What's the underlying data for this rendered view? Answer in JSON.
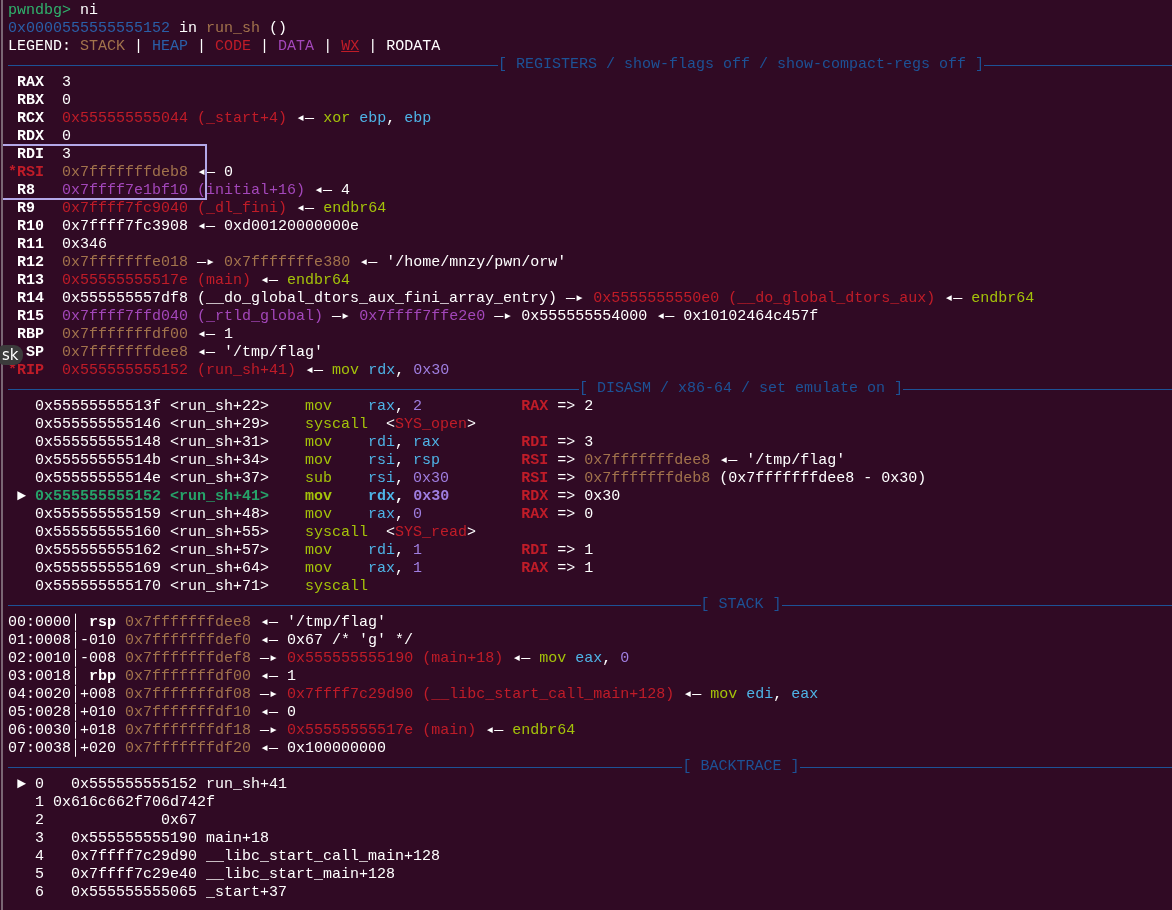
{
  "tooltip": {
    "text": "sk"
  },
  "lines": [
    {
      "kind": "text",
      "segments": [
        {
          "text": "pwndbg> ",
          "color": "#2fb36d",
          "kind": "plain"
        },
        {
          "text": "ni",
          "kind": "plain"
        }
      ]
    },
    {
      "kind": "text",
      "segments": [
        {
          "text": "0x0000555555555152",
          "color": "#2a5fa8",
          "kind": "plain"
        },
        {
          "text": " in ",
          "kind": "plain"
        },
        {
          "text": "run_sh",
          "color": "#a2734c",
          "kind": "plain"
        },
        {
          "text": " ()",
          "kind": "plain"
        }
      ]
    },
    {
      "kind": "text",
      "segments": [
        {
          "text": "LEGEND: ",
          "kind": "plain"
        },
        {
          "text": "STACK",
          "color": "#a2734c",
          "kind": "plain"
        },
        {
          "text": " | ",
          "kind": "plain"
        },
        {
          "text": "HEAP",
          "color": "#2a5fa8",
          "kind": "plain"
        },
        {
          "text": " | ",
          "kind": "plain"
        },
        {
          "text": "CODE",
          "color": "#c01c28",
          "kind": "plain"
        },
        {
          "text": " | ",
          "kind": "plain"
        },
        {
          "text": "DATA",
          "color": "#a347ba",
          "kind": "plain"
        },
        {
          "text": " | ",
          "kind": "plain"
        },
        {
          "text": "WX",
          "color": "#c01c28",
          "kind": "underline"
        },
        {
          "text": " | ",
          "kind": "plain"
        },
        {
          "text": "RODATA",
          "kind": "plain"
        }
      ]
    },
    {
      "kind": "rule",
      "title": "[ REGISTERS / show-flags off / show-compact-regs off ]"
    },
    {
      "kind": "text",
      "segments": [
        {
          "text": " RAX",
          "kind": "bold"
        },
        {
          "text": "  3",
          "kind": "plain"
        }
      ]
    },
    {
      "kind": "text",
      "segments": [
        {
          "text": " RBX",
          "kind": "bold"
        },
        {
          "text": "  0",
          "kind": "plain"
        }
      ]
    },
    {
      "kind": "text",
      "segments": [
        {
          "text": " RCX  ",
          "kind": "bold"
        },
        {
          "text": "0x555555555044 (_start+4)",
          "color": "#c01c28",
          "kind": "plain"
        },
        {
          "text": " ◂— ",
          "kind": "plain"
        },
        {
          "text": "xor ",
          "color": "#a4c20a",
          "kind": "plain"
        },
        {
          "text": "ebp",
          "color": "#4eb3e6",
          "kind": "plain"
        },
        {
          "text": ", ",
          "kind": "plain"
        },
        {
          "text": "ebp",
          "color": "#4eb3e6",
          "kind": "plain"
        }
      ]
    },
    {
      "kind": "text",
      "segments": [
        {
          "text": " RDX",
          "kind": "bold"
        },
        {
          "text": "  0",
          "kind": "plain"
        }
      ]
    },
    {
      "kind": "text",
      "segments": [
        {
          "text": " RDI",
          "kind": "bold"
        },
        {
          "text": "  3",
          "kind": "plain"
        }
      ]
    },
    {
      "kind": "text",
      "segments": [
        {
          "text": "*RSI  ",
          "color": "#c01c28",
          "kind": "bold"
        },
        {
          "text": "0x7fffffffdeb8",
          "color": "#a2734c",
          "kind": "plain"
        },
        {
          "text": " ◂— 0",
          "kind": "plain"
        }
      ]
    },
    {
      "kind": "text",
      "segments": [
        {
          "text": " R8   ",
          "kind": "bold"
        },
        {
          "text": "0x7ffff7e1bf10 (initial+16)",
          "color": "#a347ba",
          "kind": "plain"
        },
        {
          "text": " ◂— 4",
          "kind": "plain"
        }
      ]
    },
    {
      "kind": "text",
      "segments": [
        {
          "text": " R9   ",
          "kind": "bold"
        },
        {
          "text": "0x7ffff7fc9040 (_dl_fini)",
          "color": "#c01c28",
          "kind": "plain"
        },
        {
          "text": " ◂— ",
          "kind": "plain"
        },
        {
          "text": "endbr64",
          "color": "#a4c20a",
          "kind": "plain"
        }
      ]
    },
    {
      "kind": "text",
      "segments": [
        {
          "text": " R10",
          "kind": "bold"
        },
        {
          "text": "  0x7ffff7fc3908 ◂— 0xd00120000000e",
          "kind": "plain"
        }
      ]
    },
    {
      "kind": "text",
      "segments": [
        {
          "text": " R11",
          "kind": "bold"
        },
        {
          "text": "  0x346",
          "kind": "plain"
        }
      ]
    },
    {
      "kind": "text",
      "segments": [
        {
          "text": " R12  ",
          "kind": "bold"
        },
        {
          "text": "0x7fffffffe018",
          "color": "#a2734c",
          "kind": "plain"
        },
        {
          "text": " —▸ ",
          "kind": "plain"
        },
        {
          "text": "0x7fffffffe380",
          "color": "#a2734c",
          "kind": "plain"
        },
        {
          "text": " ◂— '/home/mnzy/pwn/orw'",
          "kind": "plain"
        }
      ]
    },
    {
      "kind": "text",
      "segments": [
        {
          "text": " R13  ",
          "kind": "bold"
        },
        {
          "text": "0x55555555517e (main)",
          "color": "#c01c28",
          "kind": "plain"
        },
        {
          "text": " ◂— ",
          "kind": "plain"
        },
        {
          "text": "endbr64",
          "color": "#a4c20a",
          "kind": "plain"
        }
      ]
    },
    {
      "kind": "text",
      "segments": [
        {
          "text": " R14",
          "kind": "bold"
        },
        {
          "text": "  0x555555557df8 (__do_global_dtors_aux_fini_array_entry) —▸ ",
          "kind": "plain"
        },
        {
          "text": "0x5555555550e0 (__do_global_dtors_aux)",
          "color": "#c01c28",
          "kind": "plain"
        },
        {
          "text": " ◂— ",
          "kind": "plain"
        },
        {
          "text": "endbr64",
          "color": "#a4c20a",
          "kind": "plain"
        }
      ]
    },
    {
      "kind": "text",
      "segments": [
        {
          "text": " R15  ",
          "kind": "bold"
        },
        {
          "text": "0x7ffff7ffd040 (_rtld_global)",
          "color": "#a347ba",
          "kind": "plain"
        },
        {
          "text": " —▸ ",
          "kind": "plain"
        },
        {
          "text": "0x7ffff7ffe2e0",
          "color": "#a347ba",
          "kind": "plain"
        },
        {
          "text": " —▸ 0x555555554000 ◂— 0x10102464c457f",
          "kind": "plain"
        }
      ]
    },
    {
      "kind": "text",
      "segments": [
        {
          "text": " RBP  ",
          "kind": "bold"
        },
        {
          "text": "0x7fffffffdf00",
          "color": "#a2734c",
          "kind": "plain"
        },
        {
          "text": " ◂— 1",
          "kind": "plain"
        }
      ]
    },
    {
      "kind": "text",
      "segments": [
        {
          "text": "  SP  ",
          "kind": "bold"
        },
        {
          "text": "0x7fffffffdee8",
          "color": "#a2734c",
          "kind": "plain"
        },
        {
          "text": " ◂— '/tmp/flag'",
          "kind": "plain"
        }
      ]
    },
    {
      "kind": "text",
      "segments": [
        {
          "text": "*RIP  ",
          "color": "#c01c28",
          "kind": "bold"
        },
        {
          "text": "0x555555555152 (run_sh+41)",
          "color": "#c01c28",
          "kind": "plain"
        },
        {
          "text": " ◂— ",
          "kind": "plain"
        },
        {
          "text": "mov ",
          "color": "#a4c20a",
          "kind": "plain"
        },
        {
          "text": "rdx",
          "color": "#4eb3e6",
          "kind": "plain"
        },
        {
          "text": ", ",
          "kind": "plain"
        },
        {
          "text": "0x30",
          "color": "#9f7ee0",
          "kind": "plain"
        }
      ]
    },
    {
      "kind": "rule",
      "title": "[ DISASM / x86-64 / set emulate on ]"
    },
    {
      "kind": "text",
      "segments": [
        {
          "text": "   0x55555555513f <run_sh+22>    ",
          "kind": "plain"
        },
        {
          "text": "mov    ",
          "color": "#a4c20a",
          "kind": "plain"
        },
        {
          "text": "rax",
          "color": "#4eb3e6",
          "kind": "plain"
        },
        {
          "text": ", ",
          "kind": "plain"
        },
        {
          "text": "2           ",
          "color": "#9f7ee0",
          "kind": "plain"
        },
        {
          "text": "RAX",
          "color": "#c01c28",
          "kind": "bold"
        },
        {
          "text": " => 2",
          "kind": "plain"
        }
      ]
    },
    {
      "kind": "text",
      "segments": [
        {
          "text": "   0x555555555146 <run_sh+29>    ",
          "kind": "plain"
        },
        {
          "text": "syscall",
          "color": "#a4c20a",
          "kind": "plain"
        },
        {
          "text": "  <",
          "kind": "plain"
        },
        {
          "text": "SYS_open",
          "color": "#c01c28",
          "kind": "plain"
        },
        {
          "text": ">",
          "kind": "plain"
        }
      ]
    },
    {
      "kind": "text",
      "segments": [
        {
          "text": "   0x555555555148 <run_sh+31>    ",
          "kind": "plain"
        },
        {
          "text": "mov    ",
          "color": "#a4c20a",
          "kind": "plain"
        },
        {
          "text": "rdi",
          "color": "#4eb3e6",
          "kind": "plain"
        },
        {
          "text": ", ",
          "kind": "plain"
        },
        {
          "text": "rax         ",
          "color": "#4eb3e6",
          "kind": "plain"
        },
        {
          "text": "RDI",
          "color": "#c01c28",
          "kind": "bold"
        },
        {
          "text": " => 3",
          "kind": "plain"
        }
      ]
    },
    {
      "kind": "text",
      "segments": [
        {
          "text": "   0x55555555514b <run_sh+34>    ",
          "kind": "plain"
        },
        {
          "text": "mov    ",
          "color": "#a4c20a",
          "kind": "plain"
        },
        {
          "text": "rsi",
          "color": "#4eb3e6",
          "kind": "plain"
        },
        {
          "text": ", ",
          "kind": "plain"
        },
        {
          "text": "rsp         ",
          "color": "#4eb3e6",
          "kind": "plain"
        },
        {
          "text": "RSI",
          "color": "#c01c28",
          "kind": "bold"
        },
        {
          "text": " => ",
          "kind": "plain"
        },
        {
          "text": "0x7fffffffdee8",
          "color": "#a2734c",
          "kind": "plain"
        },
        {
          "text": " ◂— '/tmp/flag'",
          "kind": "plain"
        }
      ]
    },
    {
      "kind": "text",
      "segments": [
        {
          "text": "   0x55555555514e <run_sh+37>    ",
          "kind": "plain"
        },
        {
          "text": "sub    ",
          "color": "#a4c20a",
          "kind": "plain"
        },
        {
          "text": "rsi",
          "color": "#4eb3e6",
          "kind": "plain"
        },
        {
          "text": ", ",
          "kind": "plain"
        },
        {
          "text": "0x30        ",
          "color": "#9f7ee0",
          "kind": "plain"
        },
        {
          "text": "RSI",
          "color": "#c01c28",
          "kind": "bold"
        },
        {
          "text": " => ",
          "kind": "plain"
        },
        {
          "text": "0x7fffffffdeb8",
          "color": "#a2734c",
          "kind": "plain"
        },
        {
          "text": " (0x7fffffffdee8 - 0x30)",
          "kind": "plain"
        }
      ]
    },
    {
      "kind": "text",
      "segments": [
        {
          "text": " ► ",
          "kind": "plain"
        },
        {
          "text": "0x555555555152 <run_sh+41>    ",
          "color": "#26a269",
          "kind": "bold"
        },
        {
          "text": "mov    ",
          "color": "#a4c20a",
          "kind": "bold"
        },
        {
          "text": "rdx",
          "color": "#4eb3e6",
          "kind": "bold"
        },
        {
          "text": ", ",
          "kind": "bold"
        },
        {
          "text": "0x30        ",
          "color": "#9f7ee0",
          "kind": "bold"
        },
        {
          "text": "RDX",
          "color": "#c01c28",
          "kind": "bold"
        },
        {
          "text": " => 0x30",
          "kind": "plain"
        }
      ]
    },
    {
      "kind": "text",
      "segments": [
        {
          "text": "   0x555555555159 <run_sh+48>    ",
          "kind": "plain"
        },
        {
          "text": "mov    ",
          "color": "#a4c20a",
          "kind": "plain"
        },
        {
          "text": "rax",
          "color": "#4eb3e6",
          "kind": "plain"
        },
        {
          "text": ", ",
          "kind": "plain"
        },
        {
          "text": "0           ",
          "color": "#9f7ee0",
          "kind": "plain"
        },
        {
          "text": "RAX",
          "color": "#c01c28",
          "kind": "bold"
        },
        {
          "text": " => 0",
          "kind": "plain"
        }
      ]
    },
    {
      "kind": "text",
      "segments": [
        {
          "text": "   0x555555555160 <run_sh+55>    ",
          "kind": "plain"
        },
        {
          "text": "syscall",
          "color": "#a4c20a",
          "kind": "plain"
        },
        {
          "text": "  <",
          "kind": "plain"
        },
        {
          "text": "SYS_read",
          "color": "#c01c28",
          "kind": "plain"
        },
        {
          "text": ">",
          "kind": "plain"
        }
      ]
    },
    {
      "kind": "text",
      "segments": [
        {
          "text": "   0x555555555162 <run_sh+57>    ",
          "kind": "plain"
        },
        {
          "text": "mov    ",
          "color": "#a4c20a",
          "kind": "plain"
        },
        {
          "text": "rdi",
          "color": "#4eb3e6",
          "kind": "plain"
        },
        {
          "text": ", ",
          "kind": "plain"
        },
        {
          "text": "1           ",
          "color": "#9f7ee0",
          "kind": "plain"
        },
        {
          "text": "RDI",
          "color": "#c01c28",
          "kind": "bold"
        },
        {
          "text": " => 1",
          "kind": "plain"
        }
      ]
    },
    {
      "kind": "text",
      "segments": [
        {
          "text": "   0x555555555169 <run_sh+64>    ",
          "kind": "plain"
        },
        {
          "text": "mov    ",
          "color": "#a4c20a",
          "kind": "plain"
        },
        {
          "text": "rax",
          "color": "#4eb3e6",
          "kind": "plain"
        },
        {
          "text": ", ",
          "kind": "plain"
        },
        {
          "text": "1           ",
          "color": "#9f7ee0",
          "kind": "plain"
        },
        {
          "text": "RAX",
          "color": "#c01c28",
          "kind": "bold"
        },
        {
          "text": " => 1",
          "kind": "plain"
        }
      ]
    },
    {
      "kind": "text",
      "segments": [
        {
          "text": "   0x555555555170 <run_sh+71>    ",
          "kind": "plain"
        },
        {
          "text": "syscall",
          "color": "#a4c20a",
          "kind": "plain"
        }
      ]
    },
    {
      "kind": "rule",
      "title": "[ STACK ]"
    },
    {
      "kind": "text",
      "segments": [
        {
          "text": "00:0000│ ",
          "kind": "plain"
        },
        {
          "text": "rsp ",
          "kind": "bold"
        },
        {
          "text": "0x7fffffffdee8",
          "color": "#a2734c",
          "kind": "plain"
        },
        {
          "text": " ◂— '/tmp/flag'",
          "kind": "plain"
        }
      ]
    },
    {
      "kind": "text",
      "segments": [
        {
          "text": "01:0008│-010 ",
          "kind": "plain"
        },
        {
          "text": "0x7fffffffdef0",
          "color": "#a2734c",
          "kind": "plain"
        },
        {
          "text": " ◂— 0x67 /* 'g' */",
          "kind": "plain"
        }
      ]
    },
    {
      "kind": "text",
      "segments": [
        {
          "text": "02:0010│-008 ",
          "kind": "plain"
        },
        {
          "text": "0x7fffffffdef8",
          "color": "#a2734c",
          "kind": "plain"
        },
        {
          "text": " —▸ ",
          "kind": "plain"
        },
        {
          "text": "0x555555555190 (main+18)",
          "color": "#c01c28",
          "kind": "plain"
        },
        {
          "text": " ◂— ",
          "kind": "plain"
        },
        {
          "text": "mov ",
          "color": "#a4c20a",
          "kind": "plain"
        },
        {
          "text": "eax",
          "color": "#4eb3e6",
          "kind": "plain"
        },
        {
          "text": ", ",
          "kind": "plain"
        },
        {
          "text": "0",
          "color": "#9f7ee0",
          "kind": "plain"
        }
      ]
    },
    {
      "kind": "text",
      "segments": [
        {
          "text": "03:0018│ ",
          "kind": "plain"
        },
        {
          "text": "rbp ",
          "kind": "bold"
        },
        {
          "text": "0x7fffffffdf00",
          "color": "#a2734c",
          "kind": "plain"
        },
        {
          "text": " ◂— 1",
          "kind": "plain"
        }
      ]
    },
    {
      "kind": "text",
      "segments": [
        {
          "text": "04:0020│+008 ",
          "kind": "plain"
        },
        {
          "text": "0x7fffffffdf08",
          "color": "#a2734c",
          "kind": "plain"
        },
        {
          "text": " —▸ ",
          "kind": "plain"
        },
        {
          "text": "0x7ffff7c29d90 (__libc_start_call_main+128)",
          "color": "#c01c28",
          "kind": "plain"
        },
        {
          "text": " ◂— ",
          "kind": "plain"
        },
        {
          "text": "mov ",
          "color": "#a4c20a",
          "kind": "plain"
        },
        {
          "text": "edi",
          "color": "#4eb3e6",
          "kind": "plain"
        },
        {
          "text": ", ",
          "kind": "plain"
        },
        {
          "text": "eax",
          "color": "#4eb3e6",
          "kind": "plain"
        }
      ]
    },
    {
      "kind": "text",
      "segments": [
        {
          "text": "05:0028│+010 ",
          "kind": "plain"
        },
        {
          "text": "0x7fffffffdf10",
          "color": "#a2734c",
          "kind": "plain"
        },
        {
          "text": " ◂— 0",
          "kind": "plain"
        }
      ]
    },
    {
      "kind": "text",
      "segments": [
        {
          "text": "06:0030│+018 ",
          "kind": "plain"
        },
        {
          "text": "0x7fffffffdf18",
          "color": "#a2734c",
          "kind": "plain"
        },
        {
          "text": " —▸ ",
          "kind": "plain"
        },
        {
          "text": "0x55555555517e (main)",
          "color": "#c01c28",
          "kind": "plain"
        },
        {
          "text": " ◂— ",
          "kind": "plain"
        },
        {
          "text": "endbr64",
          "color": "#a4c20a",
          "kind": "plain"
        }
      ]
    },
    {
      "kind": "text",
      "segments": [
        {
          "text": "07:0038│+020 ",
          "kind": "plain"
        },
        {
          "text": "0x7fffffffdf20",
          "color": "#a2734c",
          "kind": "plain"
        },
        {
          "text": " ◂— 0x100000000",
          "kind": "plain"
        }
      ]
    },
    {
      "kind": "rule",
      "title": "[ BACKTRACE ]"
    },
    {
      "kind": "text",
      "segments": [
        {
          "text": " ► 0   0x555555555152 run_sh+41",
          "kind": "plain"
        }
      ]
    },
    {
      "kind": "text",
      "segments": [
        {
          "text": "   1 0x616c662f706d742f",
          "kind": "plain"
        }
      ]
    },
    {
      "kind": "text",
      "segments": [
        {
          "text": "   2             0x67",
          "kind": "plain"
        }
      ]
    },
    {
      "kind": "text",
      "segments": [
        {
          "text": "   3   0x555555555190 main+18",
          "kind": "plain"
        }
      ]
    },
    {
      "kind": "text",
      "segments": [
        {
          "text": "   4   0x7ffff7c29d90 __libc_start_call_main+128",
          "kind": "plain"
        }
      ]
    },
    {
      "kind": "text",
      "segments": [
        {
          "text": "   5   0x7ffff7c29e40 __libc_start_main+128",
          "kind": "plain"
        }
      ]
    },
    {
      "kind": "text",
      "segments": [
        {
          "text": "   6   0x555555555065 _start+37",
          "kind": "plain"
        }
      ]
    }
  ]
}
